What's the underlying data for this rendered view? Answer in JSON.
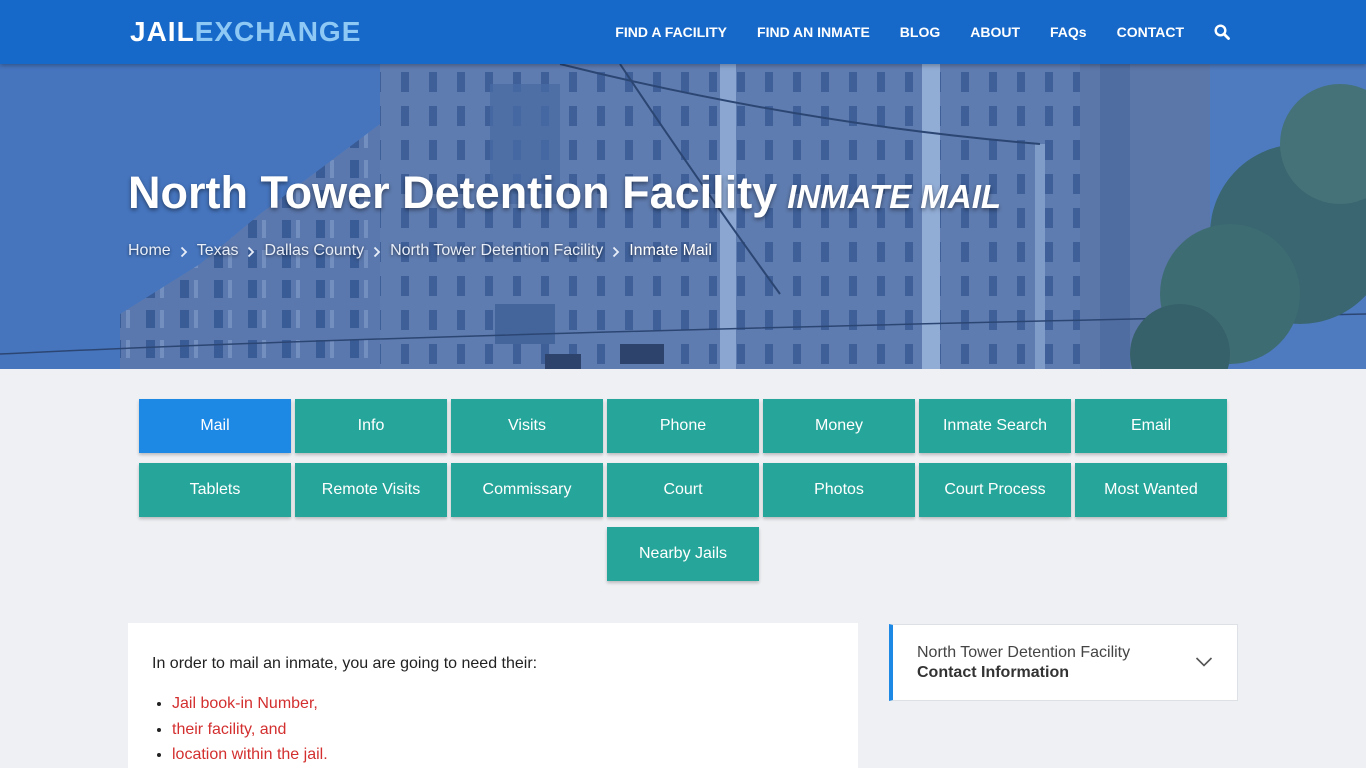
{
  "header": {
    "logo_part1": "JAIL",
    "logo_part2": "EXCHANGE",
    "nav": [
      "FIND A FACILITY",
      "FIND AN INMATE",
      "BLOG",
      "ABOUT",
      "FAQs",
      "CONTACT"
    ],
    "search_icon": "search-icon"
  },
  "hero": {
    "title": "North Tower Detention Facility",
    "subtitle": "INMATE MAIL",
    "breadcrumbs": [
      "Home",
      "Texas",
      "Dallas County",
      "North Tower Detention Facility"
    ],
    "breadcrumb_current": "Inmate Mail"
  },
  "tabs": {
    "items": [
      "Mail",
      "Info",
      "Visits",
      "Phone",
      "Money",
      "Inmate Search",
      "Email",
      "Tablets",
      "Remote Visits",
      "Commissary",
      "Court",
      "Photos",
      "Court Process",
      "Most Wanted",
      "Nearby Jails"
    ],
    "active": "Mail"
  },
  "content": {
    "intro": "In order to mail an inmate, you are going to need their:",
    "list": [
      "Jail book-in Number,",
      "their facility, and",
      "location within the jail."
    ]
  },
  "sidebar": {
    "facility": "North Tower Detention Facility",
    "section": "Contact Information"
  },
  "colors": {
    "header": "#1769c9",
    "tab": "#26a69a",
    "tab_active": "#1e88e5",
    "link_red": "#d32f2f"
  }
}
